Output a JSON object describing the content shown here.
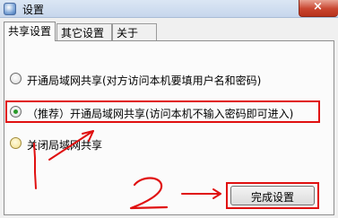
{
  "window": {
    "title": "设置",
    "close_label": "×"
  },
  "tabs": [
    {
      "label": "共享设置",
      "active": true
    },
    {
      "label": "其它设置",
      "active": false
    },
    {
      "label": "关于",
      "active": false
    }
  ],
  "options": [
    {
      "label": "开通局域网共享(对方访问本机要填用户名和密码)",
      "checked": false
    },
    {
      "label": "（推荐）开通局域网共享(访问本机不输入密码即可进入)",
      "checked": true
    },
    {
      "label": "关闭局域网共享",
      "checked": false
    }
  ],
  "button": {
    "label": "完成设置"
  },
  "annotations": {
    "step1": "1",
    "step2": "2",
    "color": "#e01010"
  }
}
